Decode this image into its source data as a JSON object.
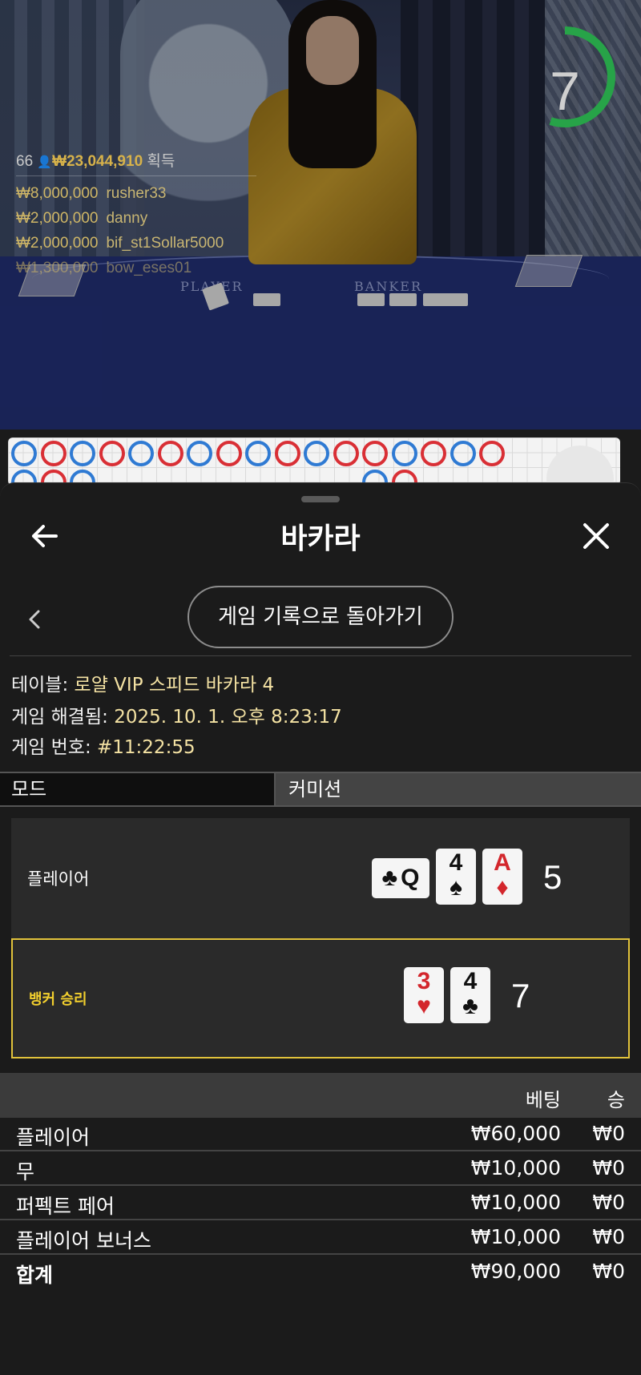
{
  "video": {
    "countdown": "7",
    "countdown_fraction": 0.55,
    "felt_labels": [
      "PLAYER",
      "BANKER"
    ],
    "winners_header": {
      "players": "66",
      "amount": "₩23,044,910",
      "suffix": "획득"
    },
    "winners": [
      {
        "amount": "₩8,000,000",
        "user": "rusher33"
      },
      {
        "amount": "₩2,000,000",
        "user": "danny"
      },
      {
        "amount": "₩2,000,000",
        "user": "bif_st1Sollar5000"
      },
      {
        "amount": "₩1,300,000",
        "user": "bow_eses01"
      }
    ]
  },
  "roadmap": {
    "colors": {
      "player": "#2f7ad3",
      "banker": "#d92f35"
    }
  },
  "sheet": {
    "title": "바카라",
    "back_icon": "arrow-left-icon",
    "close_icon": "close-icon",
    "history_button": "게임 기록으로 돌아가기",
    "info": {
      "table_label": "테이블:",
      "table_value": "로얄 VIP 스피드 바카라 4",
      "resolved_label": "게임 해결됨:",
      "resolved_value": "2025. 10. 1. 오후 8:23:17",
      "number_label": "게임 번호:",
      "number_value": "#11:22:55"
    },
    "mode": {
      "label": "모드",
      "value": "커미션"
    },
    "player_hand": {
      "label": "플레이어",
      "score": "5",
      "cards": [
        {
          "rank": "Q",
          "suit": "♣",
          "color": "black",
          "sideways": true
        },
        {
          "rank": "4",
          "suit": "♠",
          "color": "black"
        },
        {
          "rank": "A",
          "suit": "♦",
          "color": "red"
        }
      ]
    },
    "banker_hand": {
      "label": "뱅커 승리",
      "score": "7",
      "cards": [
        {
          "rank": "3",
          "suit": "♥",
          "color": "red"
        },
        {
          "rank": "4",
          "suit": "♣",
          "color": "black"
        }
      ]
    },
    "bets": {
      "header_bet": "베팅",
      "header_win": "승",
      "rows": [
        {
          "name": "플레이어",
          "bet": "₩60,000",
          "win": "₩0"
        },
        {
          "name": "무",
          "bet": "₩10,000",
          "win": "₩0"
        },
        {
          "name": "퍼펙트 페어",
          "bet": "₩10,000",
          "win": "₩0"
        },
        {
          "name": "플레이어 보너스",
          "bet": "₩10,000",
          "win": "₩0"
        }
      ],
      "total": {
        "name": "합계",
        "bet": "₩90,000",
        "win": "₩0"
      }
    },
    "accent_color": "#e1c23b"
  }
}
